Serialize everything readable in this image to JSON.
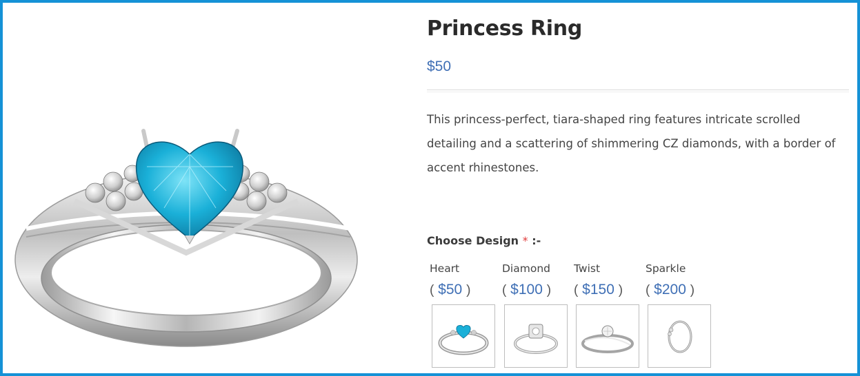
{
  "product": {
    "title": "Princess Ring",
    "price": "$50",
    "description": "This princess-perfect, tiara-shaped ring features intricate scrolled detailing and a scattering of shimmering CZ diamonds, with a border of accent rhinestones."
  },
  "design": {
    "label": "Choose Design",
    "required_mark": "*",
    "suffix": ":-",
    "open_paren": "(",
    "close_paren": ")",
    "options": [
      {
        "name": "Heart",
        "price": "$50"
      },
      {
        "name": "Diamond",
        "price": "$100"
      },
      {
        "name": "Twist",
        "price": "$150"
      },
      {
        "name": "Sparkle",
        "price": "$200"
      }
    ]
  },
  "colors": {
    "frame": "#1592d6",
    "accent_price": "#3f6fb5",
    "gem_blue": "#1ab0d8",
    "required": "#e03b3b"
  }
}
